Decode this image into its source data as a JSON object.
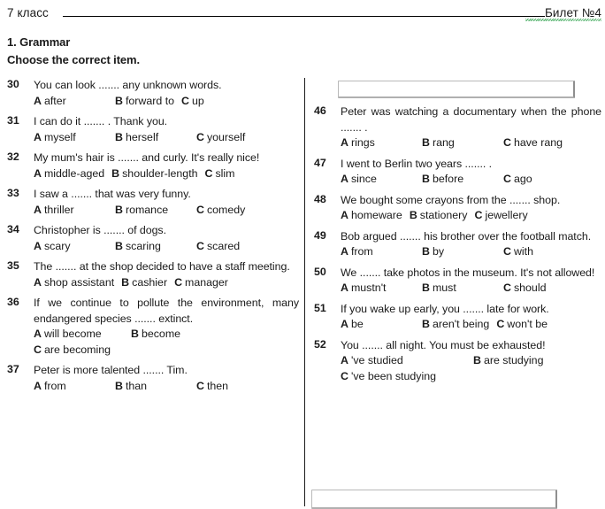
{
  "header": {
    "left_label": "7 класс",
    "right_label": "Билет №4"
  },
  "section": {
    "title": "1. Grammar",
    "instruction": "Choose the correct item."
  },
  "left_column": [
    {
      "number": "30",
      "text": "You can look ....... any unknown words.",
      "options": [
        {
          "letter": "A",
          "text": "after"
        },
        {
          "letter": "B",
          "text": "forward to"
        },
        {
          "letter": "C",
          "text": "up"
        }
      ]
    },
    {
      "number": "31",
      "text": "I can do it ....... . Thank you.",
      "options": [
        {
          "letter": "A",
          "text": "myself"
        },
        {
          "letter": "B",
          "text": "herself"
        },
        {
          "letter": "C",
          "text": "yourself"
        }
      ]
    },
    {
      "number": "32",
      "text": "My mum's hair is ....... and curly. It's really nice!",
      "options": [
        {
          "letter": "A",
          "text": "middle-aged"
        },
        {
          "letter": "B",
          "text": "shoulder-length"
        },
        {
          "letter": "C",
          "text": "slim"
        }
      ]
    },
    {
      "number": "33",
      "text": "I saw a ....... that was very funny.",
      "options": [
        {
          "letter": "A",
          "text": "thriller"
        },
        {
          "letter": "B",
          "text": "romance"
        },
        {
          "letter": "C",
          "text": "comedy"
        }
      ]
    },
    {
      "number": "34",
      "text": "Christopher is ....... of dogs.",
      "options": [
        {
          "letter": "A",
          "text": "scary"
        },
        {
          "letter": "B",
          "text": "scaring"
        },
        {
          "letter": "C",
          "text": "scared"
        }
      ]
    },
    {
      "number": "35",
      "text": "The ....... at the shop decided to have a staff meeting.",
      "options": [
        {
          "letter": "A",
          "text": "shop assistant"
        },
        {
          "letter": "B",
          "text": "cashier"
        },
        {
          "letter": "C",
          "text": "manager"
        }
      ]
    },
    {
      "number": "36",
      "text": "If we continue to pollute the environment, many endangered species ....... extinct.",
      "options": [
        {
          "letter": "A",
          "text": "will become"
        },
        {
          "letter": "B",
          "text": "become"
        },
        {
          "letter": "C",
          "text": "are becoming"
        }
      ]
    },
    {
      "number": "37",
      "text": "Peter is more talented ....... Tim.",
      "options": [
        {
          "letter": "A",
          "text": "from"
        },
        {
          "letter": "B",
          "text": "than"
        },
        {
          "letter": "C",
          "text": "then"
        }
      ]
    }
  ],
  "right_column": [
    {
      "number": "46",
      "text": "Peter was watching a documentary when the phone ....... .",
      "options": [
        {
          "letter": "A",
          "text": "rings"
        },
        {
          "letter": "B",
          "text": "rang"
        },
        {
          "letter": "C",
          "text": "have rang"
        }
      ]
    },
    {
      "number": "47",
      "text": "I went to Berlin two years ....... .",
      "options": [
        {
          "letter": "A",
          "text": "since"
        },
        {
          "letter": "B",
          "text": "before"
        },
        {
          "letter": "C",
          "text": "ago"
        }
      ]
    },
    {
      "number": "48",
      "text": "We bought some crayons from the ....... shop.",
      "options": [
        {
          "letter": "A",
          "text": "homeware"
        },
        {
          "letter": "B",
          "text": "stationery"
        },
        {
          "letter": "C",
          "text": "jewellery"
        }
      ]
    },
    {
      "number": "49",
      "text": "Bob argued ....... his brother over the football match.",
      "options": [
        {
          "letter": "A",
          "text": "from"
        },
        {
          "letter": "B",
          "text": "by"
        },
        {
          "letter": "C",
          "text": "with"
        }
      ]
    },
    {
      "number": "50",
      "text": "We ....... take photos in the museum. It's not allowed!",
      "options": [
        {
          "letter": "A",
          "text": "mustn't"
        },
        {
          "letter": "B",
          "text": "must"
        },
        {
          "letter": "C",
          "text": "should"
        }
      ]
    },
    {
      "number": "51",
      "text": "If you wake up early, you ....... late for work.",
      "options": [
        {
          "letter": "A",
          "text": "be"
        },
        {
          "letter": "B",
          "text": "aren't being"
        },
        {
          "letter": "C",
          "text": "won't be"
        }
      ]
    },
    {
      "number": "52",
      "text": "You ....... all night. You must be exhausted!",
      "options": [
        {
          "letter": "A",
          "text": "'ve studied"
        },
        {
          "letter": "B",
          "text": "are studying"
        },
        {
          "letter": "C",
          "text": "'ve been studying"
        }
      ]
    }
  ],
  "answer_boxes": {
    "top_value": "",
    "bottom_value": ""
  }
}
